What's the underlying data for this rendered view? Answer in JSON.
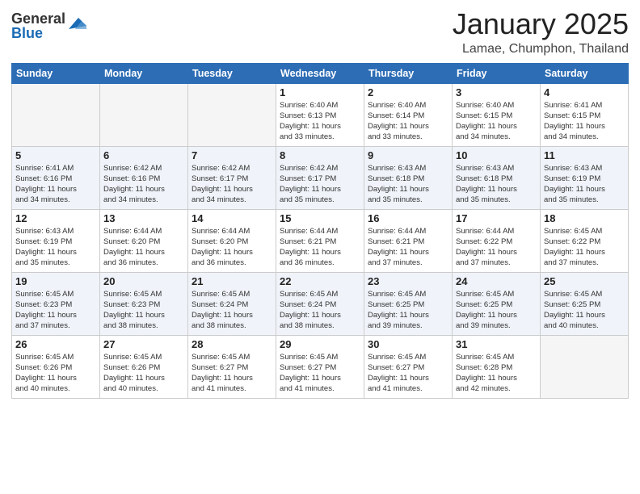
{
  "logo": {
    "general": "General",
    "blue": "Blue"
  },
  "header": {
    "month": "January 2025",
    "location": "Lamae, Chumphon, Thailand"
  },
  "weekdays": [
    "Sunday",
    "Monday",
    "Tuesday",
    "Wednesday",
    "Thursday",
    "Friday",
    "Saturday"
  ],
  "weeks": [
    [
      {
        "day": "",
        "info": ""
      },
      {
        "day": "",
        "info": ""
      },
      {
        "day": "",
        "info": ""
      },
      {
        "day": "1",
        "info": "Sunrise: 6:40 AM\nSunset: 6:13 PM\nDaylight: 11 hours\nand 33 minutes."
      },
      {
        "day": "2",
        "info": "Sunrise: 6:40 AM\nSunset: 6:14 PM\nDaylight: 11 hours\nand 33 minutes."
      },
      {
        "day": "3",
        "info": "Sunrise: 6:40 AM\nSunset: 6:15 PM\nDaylight: 11 hours\nand 34 minutes."
      },
      {
        "day": "4",
        "info": "Sunrise: 6:41 AM\nSunset: 6:15 PM\nDaylight: 11 hours\nand 34 minutes."
      }
    ],
    [
      {
        "day": "5",
        "info": "Sunrise: 6:41 AM\nSunset: 6:16 PM\nDaylight: 11 hours\nand 34 minutes."
      },
      {
        "day": "6",
        "info": "Sunrise: 6:42 AM\nSunset: 6:16 PM\nDaylight: 11 hours\nand 34 minutes."
      },
      {
        "day": "7",
        "info": "Sunrise: 6:42 AM\nSunset: 6:17 PM\nDaylight: 11 hours\nand 34 minutes."
      },
      {
        "day": "8",
        "info": "Sunrise: 6:42 AM\nSunset: 6:17 PM\nDaylight: 11 hours\nand 35 minutes."
      },
      {
        "day": "9",
        "info": "Sunrise: 6:43 AM\nSunset: 6:18 PM\nDaylight: 11 hours\nand 35 minutes."
      },
      {
        "day": "10",
        "info": "Sunrise: 6:43 AM\nSunset: 6:18 PM\nDaylight: 11 hours\nand 35 minutes."
      },
      {
        "day": "11",
        "info": "Sunrise: 6:43 AM\nSunset: 6:19 PM\nDaylight: 11 hours\nand 35 minutes."
      }
    ],
    [
      {
        "day": "12",
        "info": "Sunrise: 6:43 AM\nSunset: 6:19 PM\nDaylight: 11 hours\nand 35 minutes."
      },
      {
        "day": "13",
        "info": "Sunrise: 6:44 AM\nSunset: 6:20 PM\nDaylight: 11 hours\nand 36 minutes."
      },
      {
        "day": "14",
        "info": "Sunrise: 6:44 AM\nSunset: 6:20 PM\nDaylight: 11 hours\nand 36 minutes."
      },
      {
        "day": "15",
        "info": "Sunrise: 6:44 AM\nSunset: 6:21 PM\nDaylight: 11 hours\nand 36 minutes."
      },
      {
        "day": "16",
        "info": "Sunrise: 6:44 AM\nSunset: 6:21 PM\nDaylight: 11 hours\nand 37 minutes."
      },
      {
        "day": "17",
        "info": "Sunrise: 6:44 AM\nSunset: 6:22 PM\nDaylight: 11 hours\nand 37 minutes."
      },
      {
        "day": "18",
        "info": "Sunrise: 6:45 AM\nSunset: 6:22 PM\nDaylight: 11 hours\nand 37 minutes."
      }
    ],
    [
      {
        "day": "19",
        "info": "Sunrise: 6:45 AM\nSunset: 6:23 PM\nDaylight: 11 hours\nand 37 minutes."
      },
      {
        "day": "20",
        "info": "Sunrise: 6:45 AM\nSunset: 6:23 PM\nDaylight: 11 hours\nand 38 minutes."
      },
      {
        "day": "21",
        "info": "Sunrise: 6:45 AM\nSunset: 6:24 PM\nDaylight: 11 hours\nand 38 minutes."
      },
      {
        "day": "22",
        "info": "Sunrise: 6:45 AM\nSunset: 6:24 PM\nDaylight: 11 hours\nand 38 minutes."
      },
      {
        "day": "23",
        "info": "Sunrise: 6:45 AM\nSunset: 6:25 PM\nDaylight: 11 hours\nand 39 minutes."
      },
      {
        "day": "24",
        "info": "Sunrise: 6:45 AM\nSunset: 6:25 PM\nDaylight: 11 hours\nand 39 minutes."
      },
      {
        "day": "25",
        "info": "Sunrise: 6:45 AM\nSunset: 6:25 PM\nDaylight: 11 hours\nand 40 minutes."
      }
    ],
    [
      {
        "day": "26",
        "info": "Sunrise: 6:45 AM\nSunset: 6:26 PM\nDaylight: 11 hours\nand 40 minutes."
      },
      {
        "day": "27",
        "info": "Sunrise: 6:45 AM\nSunset: 6:26 PM\nDaylight: 11 hours\nand 40 minutes."
      },
      {
        "day": "28",
        "info": "Sunrise: 6:45 AM\nSunset: 6:27 PM\nDaylight: 11 hours\nand 41 minutes."
      },
      {
        "day": "29",
        "info": "Sunrise: 6:45 AM\nSunset: 6:27 PM\nDaylight: 11 hours\nand 41 minutes."
      },
      {
        "day": "30",
        "info": "Sunrise: 6:45 AM\nSunset: 6:27 PM\nDaylight: 11 hours\nand 41 minutes."
      },
      {
        "day": "31",
        "info": "Sunrise: 6:45 AM\nSunset: 6:28 PM\nDaylight: 11 hours\nand 42 minutes."
      },
      {
        "day": "",
        "info": ""
      }
    ]
  ]
}
